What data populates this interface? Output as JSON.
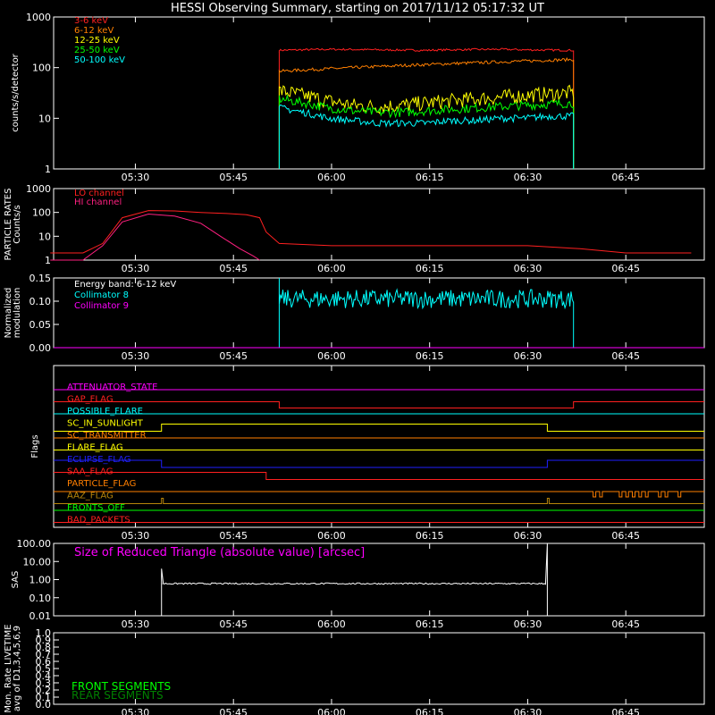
{
  "title": "HESSI Observing Summary, starting on 2017/11/12 05:17:32 UT",
  "time_ticks": [
    "05:30",
    "05:45",
    "06:00",
    "06:15",
    "06:30",
    "06:45"
  ],
  "chart_data": [
    {
      "type": "line",
      "panel": "counts",
      "ylabel": "counts/s/detector",
      "ylog": true,
      "ylim": [
        1,
        1000
      ],
      "ytick_labels": [
        "1",
        "10",
        "100",
        "1000"
      ],
      "x_unit": "UT",
      "data_window": [
        "05:52",
        "06:37"
      ],
      "series": [
        {
          "name": "3-6 keV",
          "color": "#ff2020",
          "values": [
            1,
            220,
            225,
            230,
            228,
            225,
            222,
            220,
            225,
            228,
            230,
            225,
            222,
            220,
            1
          ]
        },
        {
          "name": "6-12 keV",
          "color": "#ff7f00",
          "values": [
            1,
            85,
            90,
            95,
            100,
            105,
            110,
            115,
            120,
            125,
            130,
            135,
            140,
            145,
            1
          ]
        },
        {
          "name": "12-25 keV",
          "color": "#ffff00",
          "values": [
            1,
            35,
            28,
            22,
            18,
            17,
            18,
            20,
            22,
            24,
            26,
            28,
            30,
            32,
            1
          ]
        },
        {
          "name": "25-50 keV",
          "color": "#00ff00",
          "values": [
            1,
            24,
            20,
            16,
            14,
            13,
            13,
            14,
            15,
            16,
            17,
            18,
            19,
            20,
            1
          ]
        },
        {
          "name": "50-100 keV",
          "color": "#00ffff",
          "values": [
            1,
            16,
            13,
            10,
            9,
            8,
            8,
            8,
            9,
            9,
            10,
            10,
            11,
            11,
            1
          ]
        }
      ]
    },
    {
      "type": "line",
      "panel": "particle",
      "ylabel": "PARTICLE RATES",
      "ylabel2": "Counts/s",
      "ylog": true,
      "ylim": [
        1,
        1000
      ],
      "ytick_labels": [
        "1",
        "10",
        "100",
        "1000"
      ],
      "series": [
        {
          "name": "LO channel",
          "color": "#ff2020",
          "x": [
            "05:17",
            "05:22",
            "05:25",
            "05:28",
            "05:32",
            "05:36",
            "05:40",
            "05:44",
            "05:47",
            "05:49",
            "05:50",
            "05:52",
            "06:00",
            "06:10",
            "06:20",
            "06:30",
            "06:38",
            "06:45",
            "06:55"
          ],
          "values": [
            2,
            2,
            5,
            60,
            120,
            115,
            100,
            90,
            80,
            60,
            15,
            5,
            4,
            4,
            4,
            4,
            3,
            2,
            2
          ]
        },
        {
          "name": "HI channel",
          "color": "#ff2080",
          "x": [
            "05:17",
            "05:22",
            "05:25",
            "05:28",
            "05:32",
            "05:36",
            "05:40",
            "05:43",
            "05:46",
            "05:48",
            "05:49"
          ],
          "values": [
            1,
            1,
            4,
            40,
            85,
            70,
            35,
            10,
            3,
            1.5,
            1
          ]
        }
      ]
    },
    {
      "type": "line",
      "panel": "modulation",
      "ylabel": "Normalized",
      "ylabel2": "modulation",
      "ylim": [
        0,
        0.15
      ],
      "ytick_labels": [
        "0.00",
        "0.05",
        "0.10",
        "0.15"
      ],
      "annotation": "Energy band: 6-12 keV",
      "series": [
        {
          "name": "Collimator 8",
          "color": "#00ffff",
          "window": [
            "05:52",
            "06:37"
          ],
          "mean": 0.105
        },
        {
          "name": "Collimator 9",
          "color": "#ff00ff",
          "value": 0.0
        }
      ]
    },
    {
      "type": "line",
      "panel": "flags",
      "ylabel": "Flags",
      "flags": [
        {
          "name": "ATTENUATOR_STATE",
          "color": "#ff00ff"
        },
        {
          "name": "GAP_FLAG",
          "color": "#ff2020"
        },
        {
          "name": "POSSIBLE_FLARE",
          "color": "#00ffff"
        },
        {
          "name": "SC_IN_SUNLIGHT",
          "color": "#ffff00"
        },
        {
          "name": "SC_TRANSMITTER",
          "color": "#ff7f00"
        },
        {
          "name": "FLARE_FLAG",
          "color": "#ffff00"
        },
        {
          "name": "ECLIPSE_FLAG",
          "color": "#2020ff"
        },
        {
          "name": "SAA_FLAG",
          "color": "#ff2020"
        },
        {
          "name": "PARTICLE_FLAG",
          "color": "#ff7f00"
        },
        {
          "name": "AAZ_FLAG",
          "color": "#b8860b"
        },
        {
          "name": "FRONTS_OFF",
          "color": "#00ff00"
        },
        {
          "name": "BAD_PACKETS",
          "color": "#ff2020"
        }
      ]
    },
    {
      "type": "line",
      "panel": "sas",
      "ylabel": "SAS",
      "ylog": true,
      "ylim": [
        0.01,
        100
      ],
      "ytick_labels": [
        "0.01",
        "0.10",
        "1.00",
        "10.00",
        "100.00"
      ],
      "annotation": "Size of Reduced Triangle (absolute value) [arcsec]",
      "series": [
        {
          "name": "Size of Reduced Triangle",
          "color": "#ffffff",
          "window": [
            "05:34",
            "06:33"
          ],
          "mean": 0.6
        }
      ]
    },
    {
      "type": "line",
      "panel": "livetime",
      "ylabel": "Mon. Rate LIVETIME",
      "ylabel2": "avg of D1,3,4,5,6,9",
      "ylim": [
        0,
        1
      ],
      "ytick_labels": [
        "0.0",
        "0.1",
        "0.2",
        "0.3",
        "0.4",
        "0.5",
        "0.6",
        "0.7",
        "0.8",
        "0.9",
        "1.0"
      ],
      "legend": [
        {
          "name": "FRONT SEGMENTS",
          "color": "#00ff00"
        },
        {
          "name": "REAR SEGMENTS",
          "color": "#008000"
        }
      ]
    }
  ]
}
